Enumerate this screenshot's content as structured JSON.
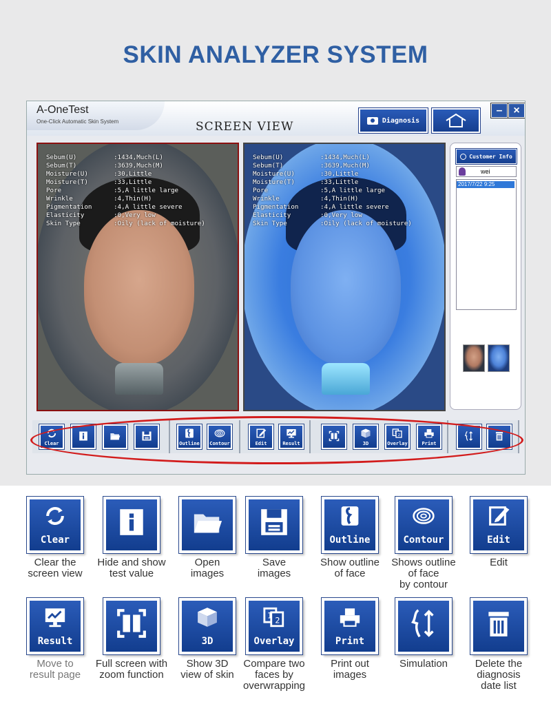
{
  "page": {
    "title": "SKIN ANALYZER SYSTEM"
  },
  "app": {
    "name": "A-OneTest",
    "subtitle": "One-Click Automatic Skin System",
    "view_title": "SCREEN VIEW",
    "diagnosis_label": "Diagnosis",
    "min_label": "–",
    "close_label": "×"
  },
  "readout": [
    {
      "key": "Sebum(U)",
      "value": ":1434,Much(L)"
    },
    {
      "key": "Sebum(T)",
      "value": ":3639,Much(M)"
    },
    {
      "key": "Moisture(U)",
      "value": ":30,Little"
    },
    {
      "key": "Moisture(T)",
      "value": ":33,Little"
    },
    {
      "key": "Pore",
      "value": ":5,A little large"
    },
    {
      "key": "Wrinkle",
      "value": ":4,Thin(H)"
    },
    {
      "key": "Pigmentation",
      "value": ":4,A little severe"
    },
    {
      "key": "Elasticity",
      "value": ":0,Very low"
    },
    {
      "key": "Skin Type",
      "value": ":Oily (lack of moisture)"
    }
  ],
  "sidebar": {
    "customer_info_label": "Customer Info",
    "customer_name": "wei",
    "dates": [
      "2017/7/22 9:25"
    ]
  },
  "toolbar": {
    "clear": "Clear",
    "outline": "Outline",
    "contour": "Contour",
    "edit": "Edit",
    "result": "Result",
    "three_d": "3D",
    "overlay": "Overlay",
    "print": "Print"
  },
  "legend": [
    {
      "label": "Clear",
      "icon": "refresh-icon",
      "caption": [
        "Clear the",
        "screen view"
      ]
    },
    {
      "label": "",
      "icon": "info-icon",
      "caption": [
        "Hide and show",
        "test value"
      ]
    },
    {
      "label": "",
      "icon": "folder-icon",
      "caption": [
        "Open",
        "images"
      ]
    },
    {
      "label": "",
      "icon": "save-icon",
      "caption": [
        "Save",
        "images"
      ]
    },
    {
      "label": "Outline",
      "icon": "face-outline-icon",
      "caption": [
        "Show outline",
        "of face"
      ]
    },
    {
      "label": "Contour",
      "icon": "contour-icon",
      "caption": [
        "Shows outline",
        "of face",
        "by contour"
      ]
    },
    {
      "label": "Edit",
      "icon": "edit-icon",
      "caption": [
        "Edit"
      ]
    },
    {
      "label": "Result",
      "icon": "monitor-icon",
      "caption": [
        "Move to",
        "result page"
      ]
    },
    {
      "label": "",
      "icon": "fullscreen-icon",
      "caption": [
        "Full screen with",
        "zoom function"
      ]
    },
    {
      "label": "3D",
      "icon": "cube-icon",
      "caption": [
        "Show 3D",
        "view of skin"
      ]
    },
    {
      "label": "Overlay",
      "icon": "overlay-icon",
      "caption": [
        "Compare two",
        "faces by",
        "overwrapping"
      ]
    },
    {
      "label": "Print",
      "icon": "printer-icon",
      "caption": [
        "Print out",
        "images"
      ]
    },
    {
      "label": "",
      "icon": "simulation-icon",
      "caption": [
        "Simulation"
      ]
    },
    {
      "label": "",
      "icon": "trash-icon",
      "caption": [
        "Delete the",
        "diagnosis",
        "date list"
      ]
    }
  ],
  "colors": {
    "accent": "#2f5fa3",
    "button": "#1d4aa0",
    "highlight": "#d21c1c"
  }
}
